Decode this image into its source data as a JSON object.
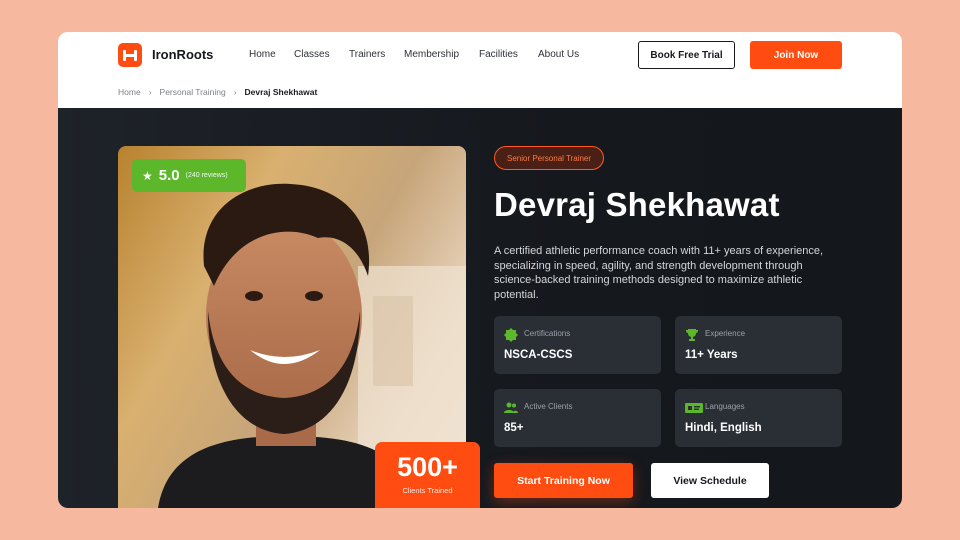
{
  "nav": {
    "brand": "IronRoots",
    "logo_icon": "dumbbell-icon",
    "links": [
      "Home",
      "Classes",
      "Trainers",
      "Membership",
      "Facilities",
      "About Us"
    ],
    "book_trial": "Book Free Trial",
    "join": "Join Now"
  },
  "breadcrumb": [
    "Home",
    "Personal Training",
    "Devraj Shekhawat"
  ],
  "trainer": {
    "tag": "Senior Personal Trainer",
    "name": "Devraj Shekhawat",
    "bio": "A certified athletic performance coach with 11+ years of experience, specializing in speed, agility, and strength development through science-backed training methods designed to maximize athletic potential.",
    "rating": "5.0",
    "rating_count": "(240 reviews)",
    "clients": "500+",
    "clients_label": "Clients Trained"
  },
  "stats": [
    {
      "icon": "badge-icon",
      "label": "Certifications",
      "value": "NSCA-CSCS"
    },
    {
      "icon": "trophy-icon",
      "label": "Experience",
      "value": "11+ Years"
    },
    {
      "icon": "users-icon",
      "label": "Active Clients",
      "value": "85+"
    },
    {
      "icon": "language-icon",
      "label": "Languages",
      "value": "Hindi, English"
    }
  ],
  "cta": {
    "start": "Start Training Now",
    "schedule": "View Schedule"
  },
  "colors": {
    "accent": "#ff4d12",
    "rating_green": "#5cb82a",
    "hero_bg": "#15181d",
    "page_bg": "#f6b9a0"
  }
}
